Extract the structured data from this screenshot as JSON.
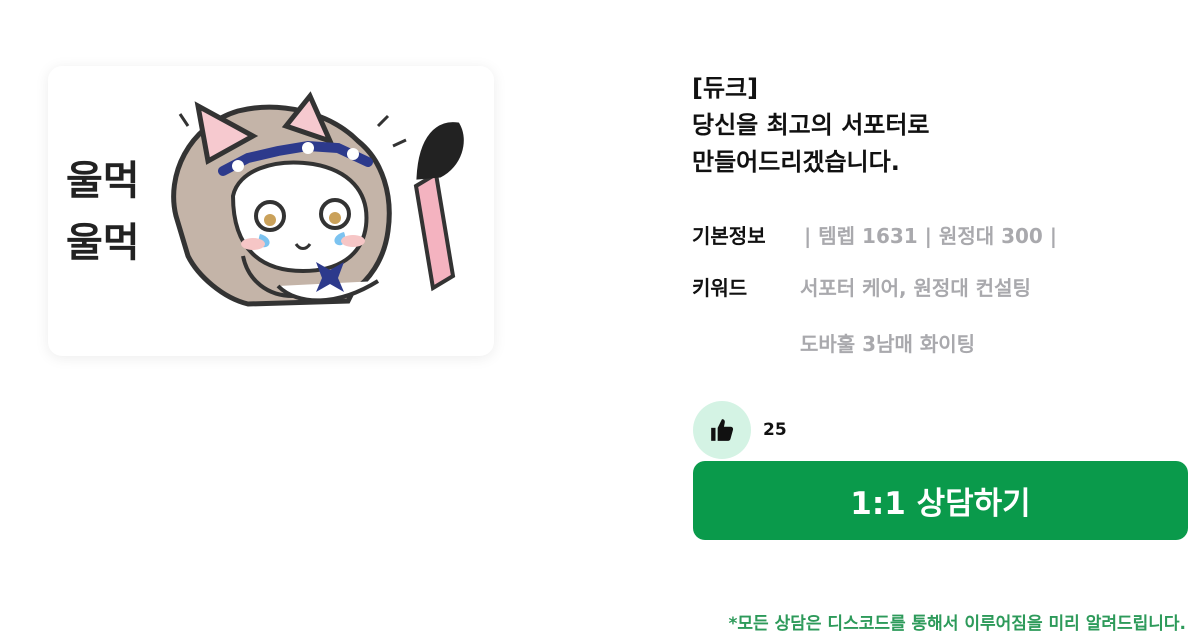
{
  "sticker": {
    "caption_line1": "울먹",
    "caption_line2": "울먹"
  },
  "profile": {
    "title_lines": [
      "[듀크]",
      "당신을 최고의 서포터로",
      "만들어드리겠습니다."
    ]
  },
  "info": {
    "basic_label": "기본정보",
    "basic_value": "| 템렙  1631 | 원정대 300 |",
    "keyword_label": "키워드",
    "keyword_line1": "서포터 케어, 원정대 컨설팅",
    "keyword_line2": "도바훌 3남매 화이팅"
  },
  "like": {
    "icon": "thumbs-up-icon",
    "count": "25"
  },
  "consult_button": {
    "label": "1:1 상담하기"
  },
  "notice": "*모든 상담은 디스코드를 통해서 이루어짐을 미리 알려드립니다.",
  "colors": {
    "accent_green": "#0a9a4b",
    "like_bg": "#d4f3e4",
    "muted_text": "#a9a9ad",
    "notice_green": "#2d9a5a"
  }
}
